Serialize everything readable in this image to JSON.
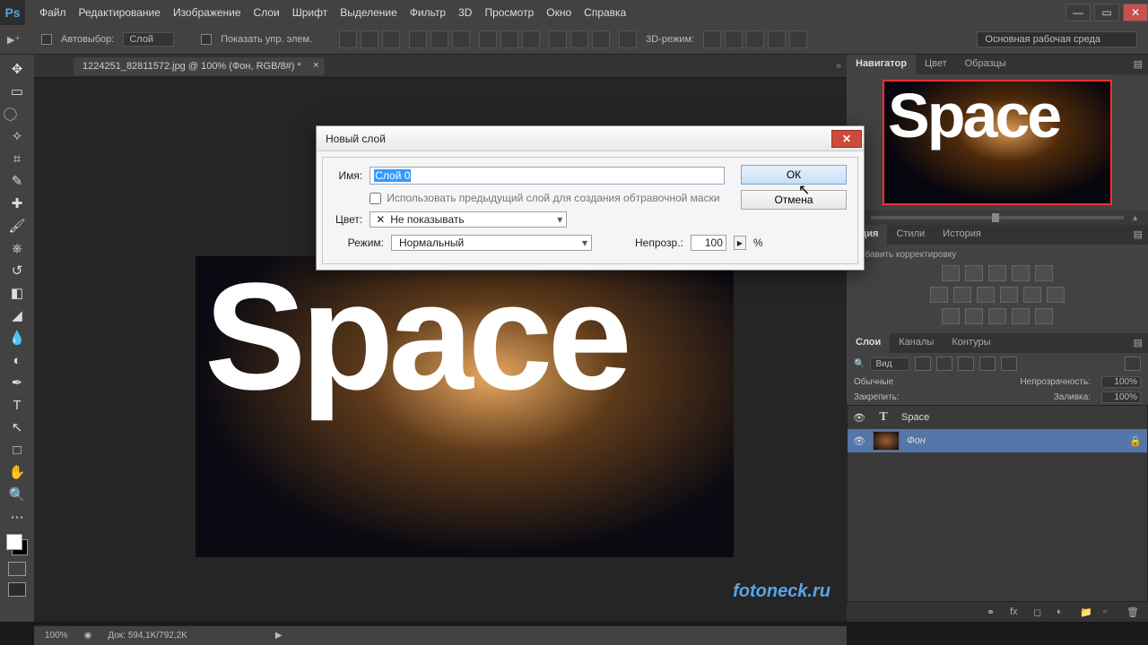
{
  "app": {
    "logo": "Ps"
  },
  "menu": [
    "Файл",
    "Редактирование",
    "Изображение",
    "Слои",
    "Шрифт",
    "Выделение",
    "Фильтр",
    "3D",
    "Просмотр",
    "Окно",
    "Справка"
  ],
  "optbar": {
    "autoselect": "Автовыбор:",
    "autoselect_value": "Слой",
    "show_transform": "Показать упр. элем.",
    "mode3d": "3D-режим:",
    "workspace": "Основная рабочая среда"
  },
  "doc_tab": {
    "title": "1224251_82811572.jpg @ 100% (Фон, RGB/8#) *"
  },
  "canvas_text": "Space",
  "watermark": "fotoneck.ru",
  "right": {
    "nav_tabs": [
      "Навигатор",
      "Цвет",
      "Образцы"
    ],
    "adj_tabs": [
      "кция",
      "Стили",
      "История"
    ],
    "adj_label": "Добавить корректировку",
    "layer_tabs": [
      "Слои",
      "Каналы",
      "Контуры"
    ],
    "kind": "Вид",
    "blend": "Обычные",
    "opacity_label": "Непрозрачность:",
    "opacity_val": "100%",
    "lock_label": "Закрепить:",
    "fill_label": "Заливка:",
    "fill_val": "100%",
    "layers": [
      {
        "name": "Space",
        "type": "T"
      },
      {
        "name": "Фон",
        "type": "bg",
        "locked": true
      }
    ]
  },
  "status": {
    "zoom": "100%",
    "docsize": "Док: 594,1K/792,2K"
  },
  "dialog": {
    "title": "Новый слой",
    "name_label": "Имя:",
    "name_value": "Слой 0",
    "clip_label": "Использовать предыдущий слой для создания обтравочной маски",
    "color_label": "Цвет:",
    "color_value": "Не показывать",
    "mode_label": "Режим:",
    "mode_value": "Нормальный",
    "opacity_label": "Непрозр.:",
    "opacity_value": "100",
    "opacity_unit": "%",
    "ok": "ОК",
    "cancel": "Отмена"
  }
}
